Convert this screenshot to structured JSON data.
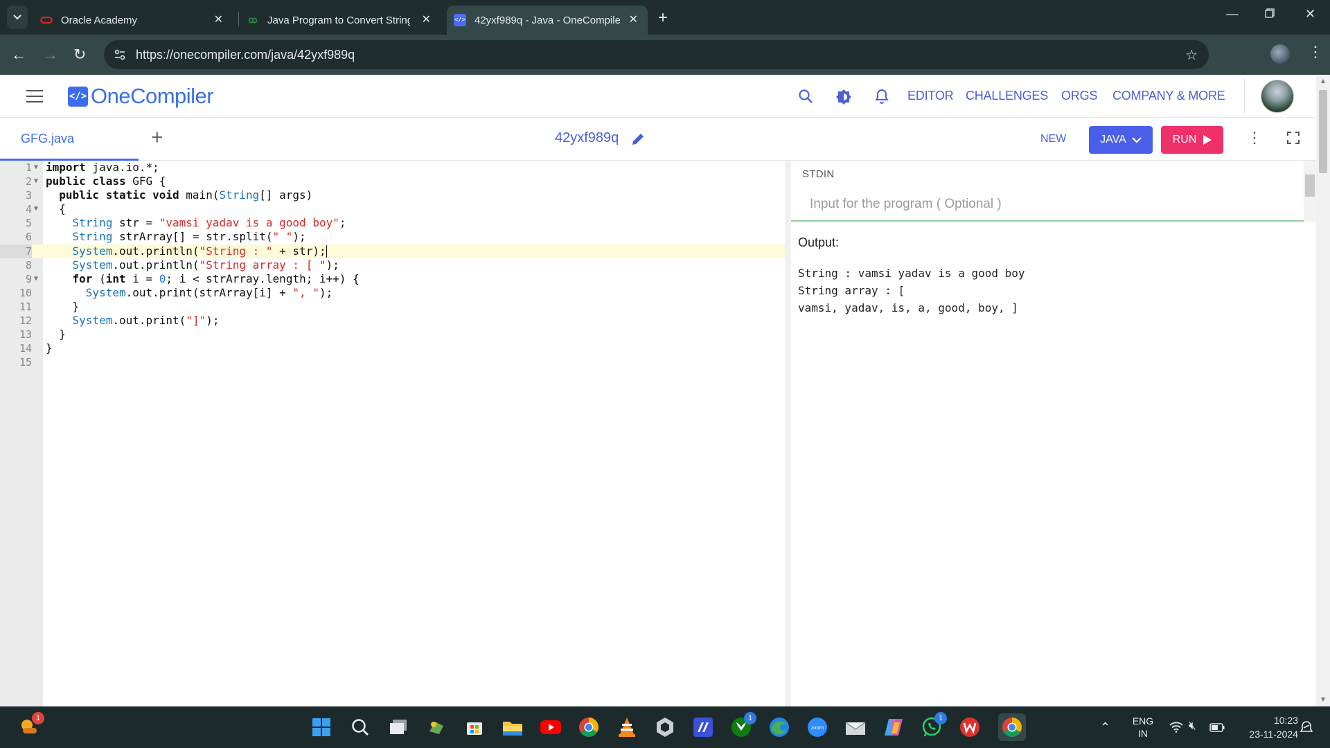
{
  "browser": {
    "tabs": [
      {
        "title": "Oracle Academy",
        "icon": "oracle-icon"
      },
      {
        "title": "Java Program to Convert String",
        "icon": "geeksforgeeks-icon"
      },
      {
        "title": "42yxf989q - Java - OneCompiler",
        "icon": "onecompiler-icon",
        "active": true
      }
    ],
    "url": "https://onecompiler.com/java/42yxf989q"
  },
  "site": {
    "logo_mark": "</>",
    "logo_name": "OneCompiler",
    "nav": [
      "EDITOR",
      "CHALLENGES",
      "ORGS",
      "COMPANY & MORE"
    ]
  },
  "toolbar": {
    "file_name": "GFG.java",
    "code_id": "42yxf989q",
    "new_label": "NEW",
    "language_label": "JAVA",
    "run_label": "RUN"
  },
  "editor": {
    "active_line": 7,
    "lines": [
      {
        "n": "1",
        "fold": true
      },
      {
        "n": "2",
        "fold": true
      },
      {
        "n": "3"
      },
      {
        "n": "4",
        "fold": true
      },
      {
        "n": "5"
      },
      {
        "n": "6"
      },
      {
        "n": "7"
      },
      {
        "n": "8"
      },
      {
        "n": "9",
        "fold": true
      },
      {
        "n": "10"
      },
      {
        "n": "11"
      },
      {
        "n": "12"
      },
      {
        "n": "13"
      },
      {
        "n": "14"
      },
      {
        "n": "15"
      }
    ],
    "code": [
      "import java.io.*;",
      "public class GFG {",
      "  public static void main(String[] args)",
      "  {",
      "    String str = \"vamsi yadav is a good boy\";",
      "    String strArray[] = str.split(\" \");",
      "    System.out.println(\"String : \" + str);",
      "    System.out.println(\"String array : [ \");",
      "    for (int i = 0; i < strArray.length; i++) {",
      "      System.out.print(strArray[i] + \", \");",
      "    }",
      "    System.out.print(\"]\");",
      "  }",
      "}",
      ""
    ]
  },
  "stdin": {
    "label": "STDIN",
    "placeholder": "Input for the program ( Optional )"
  },
  "output": {
    "label": "Output:",
    "lines": [
      "String : vamsi yadav is a good boy",
      "String array : [",
      "vamsi, yadav, is, a, good, boy, ]"
    ]
  },
  "taskbar": {
    "weather_badge": "1",
    "xbox_badge": "1",
    "whatsapp_badge": "1",
    "lang_top": "ENG",
    "lang_bottom": "IN",
    "time": "10:23",
    "date": "23-11-2024"
  },
  "colors": {
    "accent": "#3c6df0",
    "run": "#f0306a",
    "language_button": "#4a5fe8",
    "browser_dark": "#1f2d2e"
  }
}
